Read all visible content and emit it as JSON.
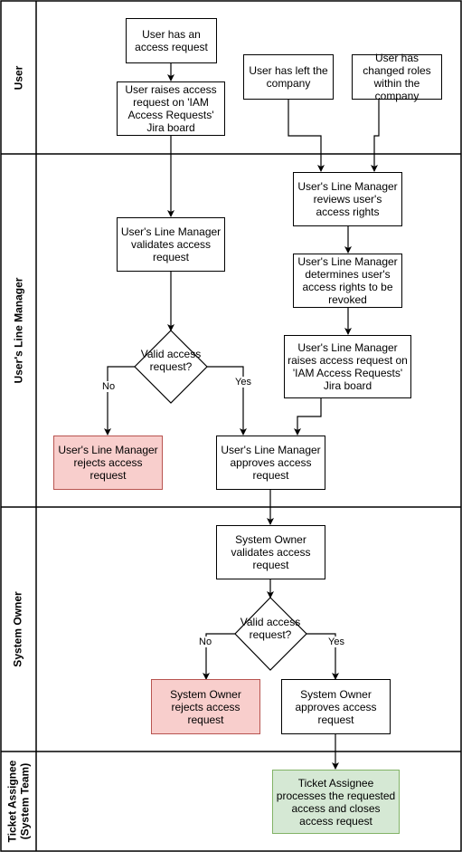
{
  "lanes": [
    {
      "id": "user",
      "title": "User"
    },
    {
      "id": "line-manager",
      "title": "User's Line Manager"
    },
    {
      "id": "system-owner",
      "title": "System Owner"
    },
    {
      "id": "ticket-assignee",
      "title": "Ticket Assignee\n(System Team)"
    }
  ],
  "nodes": {
    "user_has_request": "User has an access request",
    "user_raises_request": "User raises access request on 'IAM Access Requests' Jira board",
    "user_left_company": "User has left the company",
    "user_changed_roles": "User has changed roles within the company",
    "lm_reviews_rights": "User's Line Manager reviews user's access rights",
    "lm_validates": "User's Line Manager validates access request",
    "lm_determines_revoke": "User's Line Manager determines user's access rights to be revoked",
    "lm_raises_request": "User's Line Manager raises access request on 'IAM Access Requests' Jira board",
    "lm_decision": "Valid access request?",
    "lm_rejects": "User's Line Manager rejects access request",
    "lm_approves": "User's Line Manager approves access request",
    "so_validates": "System Owner validates access request",
    "so_decision": "Valid access request?",
    "so_rejects": "System Owner rejects access request",
    "so_approves": "System Owner approves access request",
    "ta_processes": "Ticket Assignee processes the requested access and closes access request"
  },
  "edge_labels": {
    "no": "No",
    "yes": "Yes"
  },
  "colors": {
    "reject_fill": "#f8cecc",
    "reject_stroke": "#b85450",
    "complete_fill": "#d5e8d4",
    "complete_stroke": "#82b366"
  }
}
